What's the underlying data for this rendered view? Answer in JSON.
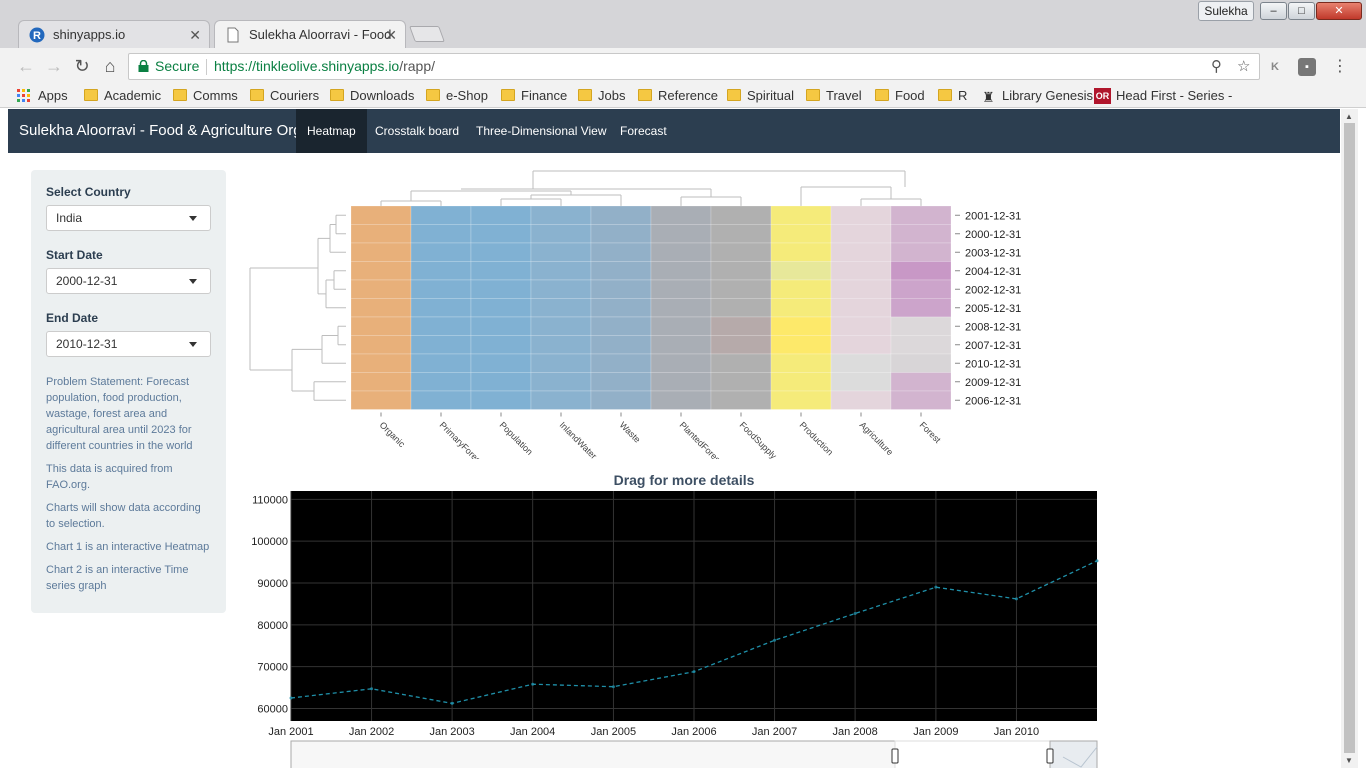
{
  "window": {
    "user": "Sulekha",
    "controls": {
      "minimize": "–",
      "maximize": "□",
      "close": "✕"
    }
  },
  "tabs": [
    {
      "title": "shinyapps.io",
      "close": "✕"
    },
    {
      "title": "Sulekha Aloorravi - Food",
      "close": "✕"
    }
  ],
  "toolbar": {
    "secure_label": "Secure",
    "url_host": "https://tinkleolive.shinyapps.io",
    "url_path": "/rapp/"
  },
  "bookmarks": [
    "Apps",
    "Academic",
    "Comms",
    "Couriers",
    "Downloads",
    "e-Shop",
    "Finance",
    "Jobs",
    "Reference",
    "Spiritual",
    "Travel",
    "Food",
    "R",
    "Library Genesis",
    "Head First - Series - C"
  ],
  "app": {
    "brand": "Sulekha Aloorravi - Food & Agriculture Org",
    "nav_tabs": [
      "Heatmap",
      "Crosstalk board",
      "Three-Dimensional View",
      "Forecast"
    ],
    "active_tab": "Heatmap"
  },
  "sidebar": {
    "country_label": "Select Country",
    "country_value": "India",
    "start_label": "Start Date",
    "start_value": "2000-12-31",
    "end_label": "End Date",
    "end_value": "2010-12-31",
    "notes": [
      "Problem Statement: Forecast population, food production, wastage, forest area and agricultural area until 2023 for different countries in the world",
      "This data is acquired from FAO.org.",
      "Charts will show data according to selection.",
      "Chart 1 is an interactive Heatmap",
      "Chart 2 is an interactive Time series graph"
    ]
  },
  "chart_data": [
    {
      "type": "heatmap",
      "columns": [
        "Organic",
        "PrimaryForest",
        "Population",
        "InlandWater",
        "Waste",
        "PlantedForest",
        "FoodSupply",
        "Production",
        "Agriculture",
        "Forest"
      ],
      "rows": [
        "2001-12-31",
        "2000-12-31",
        "2003-12-31",
        "2004-12-31",
        "2002-12-31",
        "2005-12-31",
        "2008-12-31",
        "2007-12-31",
        "2010-12-31",
        "2009-12-31",
        "2006-12-31"
      ],
      "column_colors": [
        "#e8b07a",
        "#80b1d3",
        "#80b1d3",
        "#8ab2cf",
        "#92b0c8",
        "#a9aeb5",
        "#b0b0b0",
        "#f5eb7a",
        "#e4d5dc",
        "#d2b4cf"
      ],
      "cell_overrides": [
        {
          "row": "2004-12-31",
          "column": "Forest",
          "color": "#c898c6"
        },
        {
          "row": "2002-12-31",
          "column": "Forest",
          "color": "#cca4cb"
        },
        {
          "row": "2005-12-31",
          "column": "Forest",
          "color": "#cca4cb"
        },
        {
          "row": "2004-12-31",
          "column": "Production",
          "color": "#e7e89a"
        },
        {
          "row": "2008-12-31",
          "column": "Production",
          "color": "#fde96a"
        },
        {
          "row": "2007-12-31",
          "column": "Production",
          "color": "#fde96a"
        },
        {
          "row": "2008-12-31",
          "column": "Forest",
          "color": "#dcd8da"
        },
        {
          "row": "2007-12-31",
          "column": "Forest",
          "color": "#dcd8da"
        },
        {
          "row": "2010-12-31",
          "column": "Forest",
          "color": "#d8d5d7"
        },
        {
          "row": "2008-12-31",
          "column": "FoodSupply",
          "color": "#b6aaaa"
        },
        {
          "row": "2007-12-31",
          "column": "FoodSupply",
          "color": "#b6aaaa"
        },
        {
          "row": "2010-12-31",
          "column": "Agriculture",
          "color": "#dcdcdc"
        },
        {
          "row": "2009-12-31",
          "column": "Agriculture",
          "color": "#dcdcdc"
        }
      ]
    },
    {
      "type": "line",
      "title": "Drag for more details",
      "x": [
        "2001-01-01",
        "2002-01-01",
        "2003-01-01",
        "2004-01-01",
        "2005-01-01",
        "2006-01-01",
        "2007-01-01",
        "2008-01-01",
        "2009-01-01",
        "2010-01-01",
        "2011-01-01"
      ],
      "series": [
        {
          "values": [
            62500,
            64700,
            61200,
            65800,
            65200,
            68800,
            76300,
            82700,
            89000,
            86200,
            95300
          ],
          "color": "#1f8fa8",
          "style": "dashed"
        }
      ],
      "x_tick_labels": [
        "Jan 2001",
        "Jan 2002",
        "Jan 2003",
        "Jan 2004",
        "Jan 2005",
        "Jan 2006",
        "Jan 2007",
        "Jan 2008",
        "Jan 2009",
        "Jan 2010"
      ],
      "y_ticks": [
        60000,
        70000,
        80000,
        90000,
        100000,
        110000
      ],
      "ylim": [
        57000,
        112000
      ],
      "background": "#000000",
      "grid": true
    }
  ]
}
